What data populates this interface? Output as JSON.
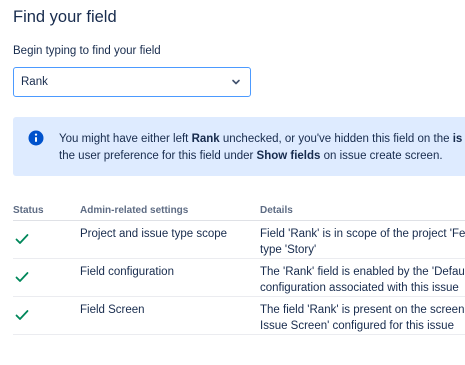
{
  "header": {
    "title": "Find your field"
  },
  "search": {
    "label": "Begin typing to find your field",
    "selected": "Rank"
  },
  "info": {
    "line1_pre": "You might have either left ",
    "line1_bold": "Rank",
    "line1_post": " unchecked, or you've hidden this field on the ",
    "line1_cut": "is",
    "line2_pre": "the user preference for this field under ",
    "line2_bold": "Show fields",
    "line2_post": " on issue create screen."
  },
  "table": {
    "headers": [
      "Status",
      "Admin-related settings",
      "Details"
    ],
    "rows": [
      {
        "setting": "Project and issue type scope",
        "details_l1": "Field 'Rank' is in scope of the project 'Fe",
        "details_l2": "type 'Story'"
      },
      {
        "setting": "Field configuration",
        "details_l1": "The 'Rank' field is enabled by the 'Defau",
        "details_l2": "configuration associated with this issue"
      },
      {
        "setting": "Field Screen",
        "details_l1": "The field 'Rank' is present on the screen",
        "details_l2": "Issue Screen' configured for this issue"
      }
    ]
  },
  "colors": {
    "accent": "#0052cc",
    "success": "#00875a",
    "info_bg": "#deebff"
  }
}
